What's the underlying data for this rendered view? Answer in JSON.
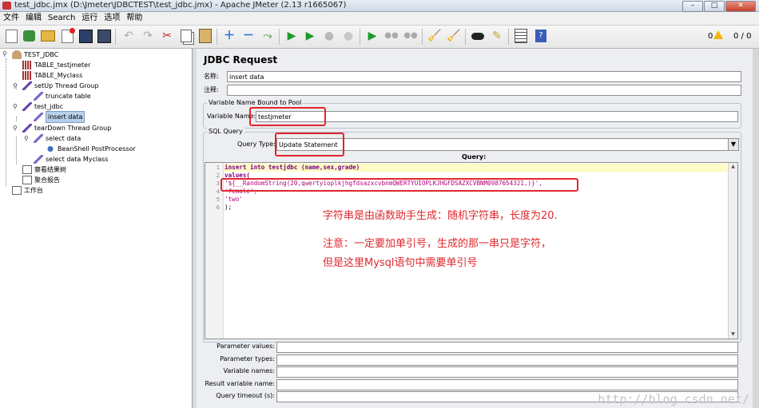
{
  "window": {
    "title": "test_jdbc.jmx (D:\\Jmeter\\JDBCTEST\\test_jdbc.jmx) - Apache JMeter (2.13 r1665067)",
    "minimize": "–",
    "maximize": "□",
    "close": "✕"
  },
  "menu": [
    "文件",
    "编辑",
    "Search",
    "运行",
    "选项",
    "帮助"
  ],
  "toolbar": {
    "icons": [
      "new-icon",
      "templates-icon",
      "open-icon",
      "close-icon",
      "save-icon",
      "save-as-icon",
      "undo-icon",
      "redo-icon",
      "cut-icon",
      "copy-icon",
      "paste-icon",
      "expand-icon",
      "collapse-icon",
      "toggle-icon",
      "start-icon",
      "start-no-pause-icon",
      "stop-icon",
      "shutdown-icon",
      "remote-start-icon",
      "remote-stop-icon",
      "remote-shutdown-icon",
      "clear-icon",
      "clear-all-icon",
      "search-icon",
      "reset-search-icon",
      "function-helper-icon",
      "help-icon"
    ],
    "warning_count": "0",
    "thread_count": "0 / 0"
  },
  "tree": [
    {
      "label": "TEST_JDBC",
      "icon": "test-plan-icon"
    },
    {
      "label": "TABLE_testjmeter",
      "icon": "jdbc-config-icon"
    },
    {
      "label": "TABLE_Myclass",
      "icon": "jdbc-config-icon"
    },
    {
      "label": "setUp Thread Group",
      "icon": "thread-group-icon"
    },
    {
      "label": "truncate table",
      "icon": "sampler-icon"
    },
    {
      "label": "test_jdbc",
      "icon": "thread-group-icon"
    },
    {
      "label": "insert data",
      "icon": "sampler-icon",
      "selected": true
    },
    {
      "label": "tearDown Thread Group",
      "icon": "thread-group-icon"
    },
    {
      "label": "select data",
      "icon": "sampler-icon"
    },
    {
      "label": "BeanShell PostProcessor",
      "icon": "postprocessor-icon"
    },
    {
      "label": "select data Myclass",
      "icon": "sampler-icon"
    },
    {
      "label": "察看结果树",
      "icon": "listener-icon"
    },
    {
      "label": "聚合报告",
      "icon": "listener-icon"
    },
    {
      "label": "工作台",
      "icon": "workbench-icon"
    }
  ],
  "panel": {
    "heading": "JDBC Request",
    "name_label": "名称:",
    "name_value": "insert data",
    "comment_label": "注释:",
    "comment_value": "",
    "pool_group_title": "Variable Name Bound to Pool",
    "variable_name_label": "Variable Name:",
    "variable_name_value": "testjmeter",
    "sql_group_title": "SQL Query",
    "query_type_label": "Query Type:",
    "query_type_value": "Update Statement",
    "query_header": "Query:",
    "line_numbers": [
      "1",
      "2",
      "3",
      "4",
      "5",
      "6"
    ],
    "code_lines": [
      "insert into testjdbc (name,sex,grade)",
      "values(",
      "'${__RandomString(20,qwertyioplkjhgfdsazxcvbnmQWERTYUIOPLKJHGFDSAZXCVBNM0987654321,)}',",
      "'female',",
      "'two'",
      ");"
    ],
    "param_values_label": "Parameter values:",
    "param_types_label": "Parameter types:",
    "variable_names_label": "Variable names:",
    "result_variable_label": "Result variable name:",
    "query_timeout_label": "Query timeout (s):"
  },
  "annotations": {
    "line1": "字符串是由函数助手生成：随机字符串，长度为20.",
    "line2": "注意：一定要加单引号，生成的那一串只是字符，",
    "line3": "但是这里Mysql语句中需要单引号",
    "color": "#e0262d"
  },
  "watermark": "http://blog.csdn.net/"
}
